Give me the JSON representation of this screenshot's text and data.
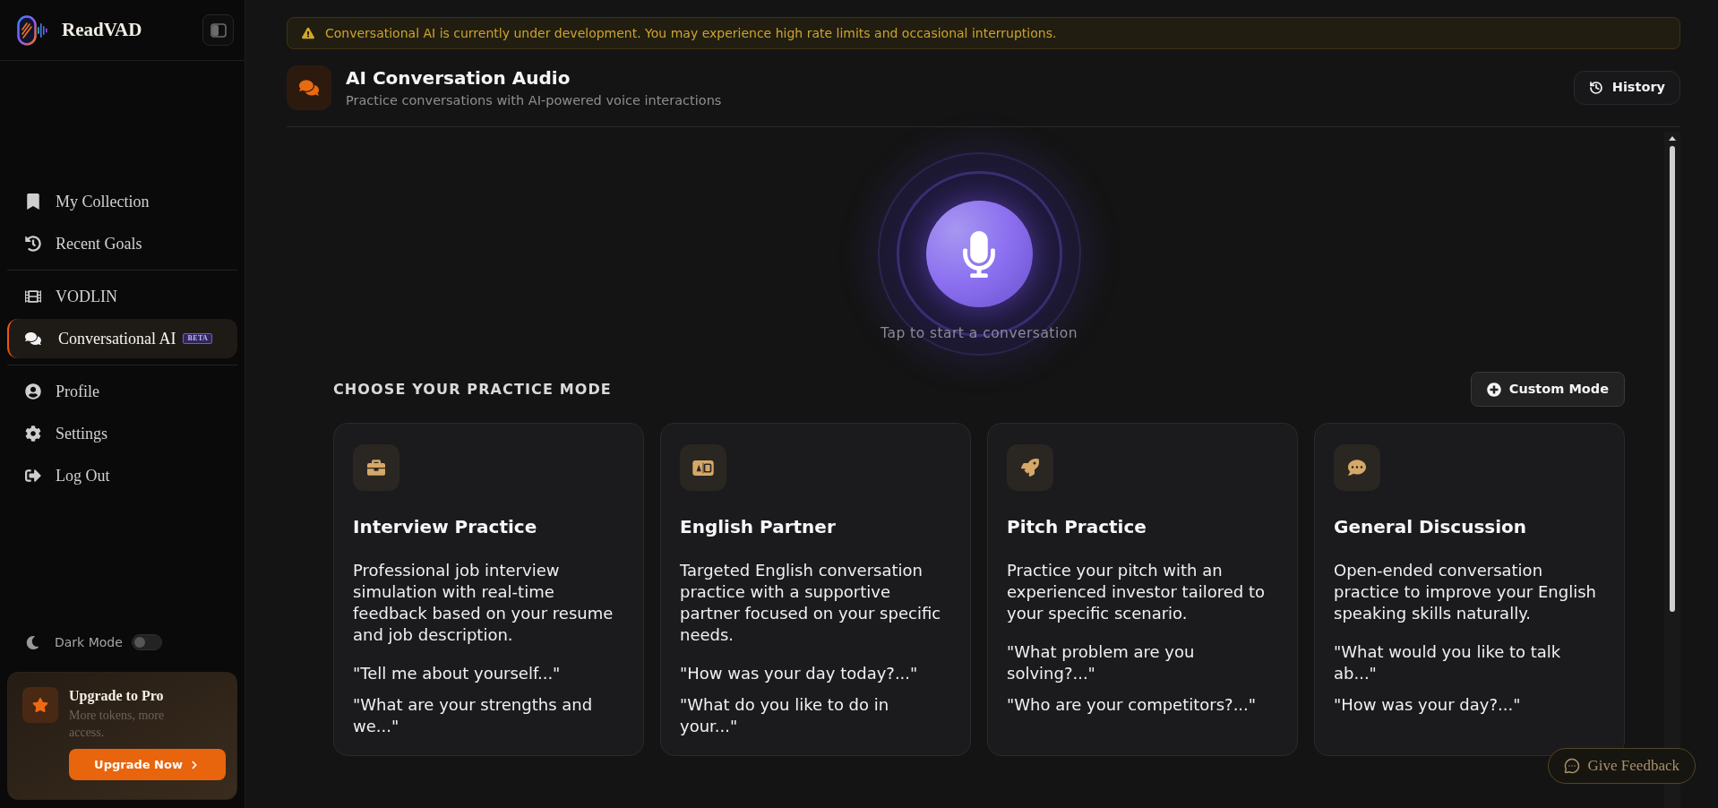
{
  "sidebar": {
    "brand": "ReadVAD",
    "groups": [
      {
        "items": [
          {
            "label": "My Collection",
            "selected": false
          },
          {
            "label": "Recent Goals",
            "selected": false
          }
        ]
      },
      {
        "items": [
          {
            "label": "VODLIN",
            "selected": false
          },
          {
            "label": "Conversational AI",
            "selected": true,
            "badge": "BETA"
          }
        ]
      },
      {
        "items": [
          {
            "label": "Profile",
            "selected": false
          },
          {
            "label": "Settings",
            "selected": false
          },
          {
            "label": "Log Out",
            "selected": false
          }
        ]
      }
    ],
    "dark_mode": {
      "label": "Dark Mode",
      "on": false
    },
    "upgrade": {
      "title": "Upgrade to Pro",
      "text": "More tokens, more access.",
      "button": "Upgrade Now"
    }
  },
  "alert": {
    "text": "Conversational AI is currently under development. You may experience high rate limits and occasional interruptions."
  },
  "header": {
    "title": "AI Conversation Audio",
    "subtitle": "Practice conversations with AI-powered voice interactions",
    "history_button": "History"
  },
  "microphone": {
    "hint": "Tap to start a conversation"
  },
  "practice": {
    "heading": "CHOOSE YOUR PRACTICE MODE",
    "custom_button": "Custom Mode",
    "modes": [
      {
        "title": "Interview Practice",
        "description": "Professional job interview simulation with real-time feedback based on your resume and job description.",
        "examples": [
          "\"Tell me about yourself...\"",
          "\"What are your strengths and we...\""
        ]
      },
      {
        "title": "English Partner",
        "description": "Targeted English conversation practice with a supportive partner focused on your specific needs.",
        "examples": [
          "\"How was your day today?...\"",
          "\"What do you like to do in your...\""
        ]
      },
      {
        "title": "Pitch Practice",
        "description": "Practice your pitch with an experienced investor tailored to your specific scenario.",
        "examples": [
          "\"What problem are you solving?...\"",
          "\"Who are your competitors?...\""
        ]
      },
      {
        "title": "General Discussion",
        "description": "Open-ended conversation practice to improve your English speaking skills naturally.",
        "examples": [
          "\"What would you like to talk ab...\"",
          "\"How was your day?...\""
        ]
      }
    ]
  },
  "feedback_button": "Give Feedback"
}
